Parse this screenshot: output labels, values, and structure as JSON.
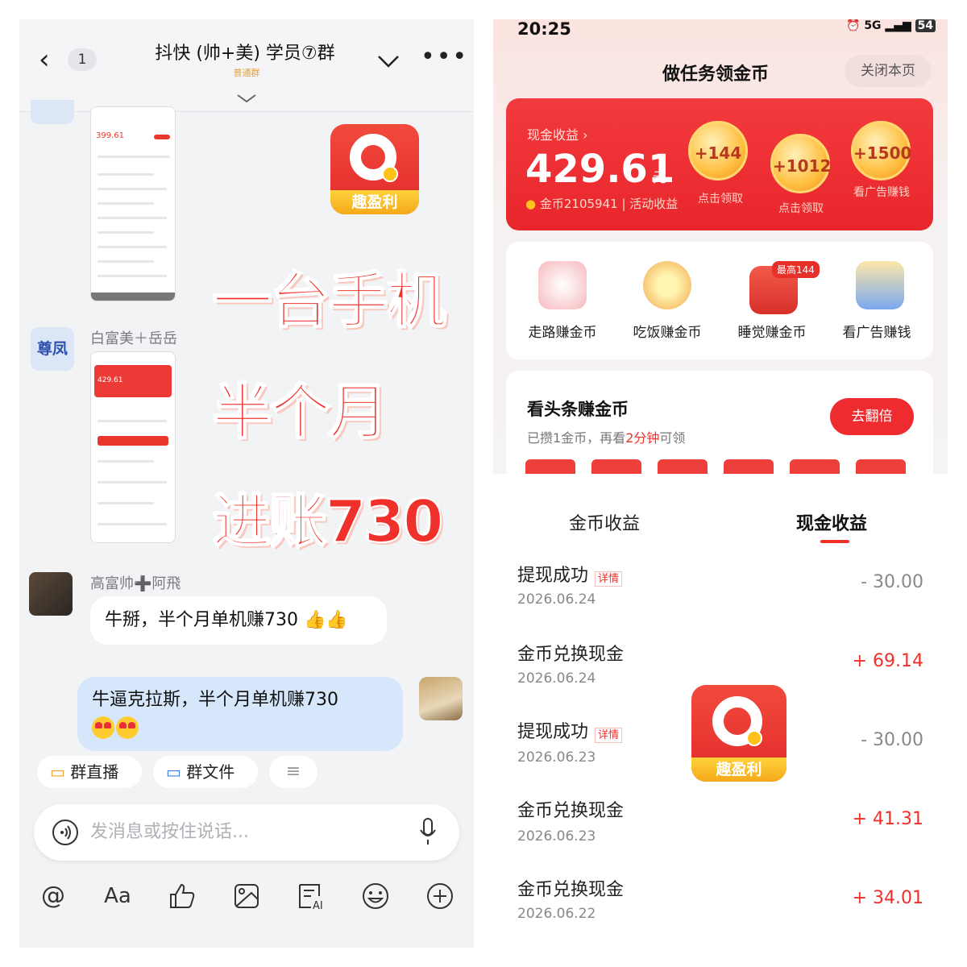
{
  "chat": {
    "unread": "1",
    "title": "抖快 (帅+美) 学员⑦群",
    "badge": "普通群",
    "sender1": "白富美＋岳岳",
    "sender1_avatar": "尊凤",
    "promo_logo": "趣盈利",
    "promo_line1": "一台手机",
    "promo_line2": "半个月",
    "promo_line3": "进账730",
    "sender2": "高富帅➕阿飛",
    "msg1": "牛掰，半个月单机赚730",
    "msg2": "牛逼克拉斯，半个月单机赚730",
    "pill_live": "群直播",
    "pill_file": "群文件",
    "input_placeholder": "发消息或按住说话...",
    "mini_balance": "399.61",
    "mini_cash": "429.61"
  },
  "tasks_page": {
    "time": "20:25",
    "battery": "54",
    "network": "5G",
    "title": "做任务领金币",
    "close_label": "关闭本页",
    "cash_label": "现金收益 ›",
    "cash_value": "429.61",
    "cash_unit": "元",
    "cash_sub": "金币2105941 | 活动收益",
    "bubbles": [
      {
        "value": "+144",
        "caption": "点击领取"
      },
      {
        "value": "+1012",
        "caption": "点击领取"
      },
      {
        "value": "+1500",
        "caption": "看广告赚钱"
      }
    ],
    "tasks": [
      {
        "label": "走路赚金币"
      },
      {
        "label": "吃饭赚金币"
      },
      {
        "label": "睡觉赚金币",
        "badge": "最高144"
      },
      {
        "label": "看广告赚钱"
      }
    ],
    "news_title": "看头条赚金币",
    "news_sub_a": "已攒1金币，再看",
    "news_sub_b": "2分钟",
    "news_sub_c": "可领",
    "double_btn": "去翻倍"
  },
  "earnings": {
    "tab1": "金币收益",
    "tab2": "现金收益",
    "detail": "详情",
    "logo": "趣盈利",
    "rows": [
      {
        "title": "提现成功",
        "date": "2026.06.24",
        "amount": "- 30.00"
      },
      {
        "title": "金币兑换现金",
        "date": "2026.06.24",
        "amount": "+ 69.14"
      },
      {
        "title": "提现成功",
        "date": "2026.06.23",
        "amount": "- 30.00"
      },
      {
        "title": "金币兑换现金",
        "date": "2026.06.23",
        "amount": "+ 41.31"
      },
      {
        "title": "金币兑换现金",
        "date": "2026.06.22",
        "amount": "+ 34.01"
      }
    ]
  },
  "colors": {
    "accent": "#f0302a",
    "chat_bubble_mine": "#d6e7fb",
    "gold": "#ffc21a"
  }
}
